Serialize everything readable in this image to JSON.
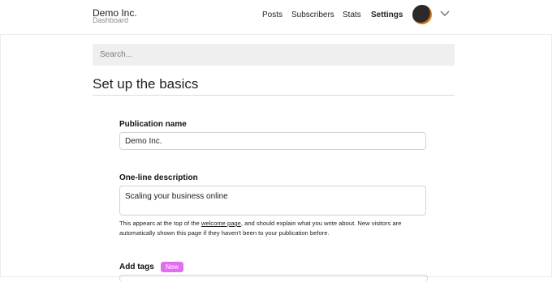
{
  "header": {
    "brand_title": "Demo Inc.",
    "brand_subtitle": "Dashboard",
    "nav": [
      "Posts",
      "Subscribers",
      "Stats",
      "Settings"
    ],
    "active_nav": "Settings",
    "avatar_icon": "user-avatar",
    "menu_icon": "chevron-down-icon"
  },
  "search": {
    "placeholder": "Search..."
  },
  "section": {
    "title": "Set up the basics"
  },
  "form": {
    "publication_name": {
      "label": "Publication name",
      "value": "Demo Inc."
    },
    "description": {
      "label": "One-line description",
      "value": "Scaling your business online",
      "help_before": "This appears at the top of the ",
      "help_link": "welcome page",
      "help_after": ", and should explain what you write about. New visitors are automatically shown this page if they haven't been to your publication before."
    },
    "tags": {
      "label": "Add tags",
      "badge": "New"
    }
  },
  "colors": {
    "badge": "#e16ef0",
    "search_bg": "#efefef",
    "border": "#d3d3d3"
  }
}
